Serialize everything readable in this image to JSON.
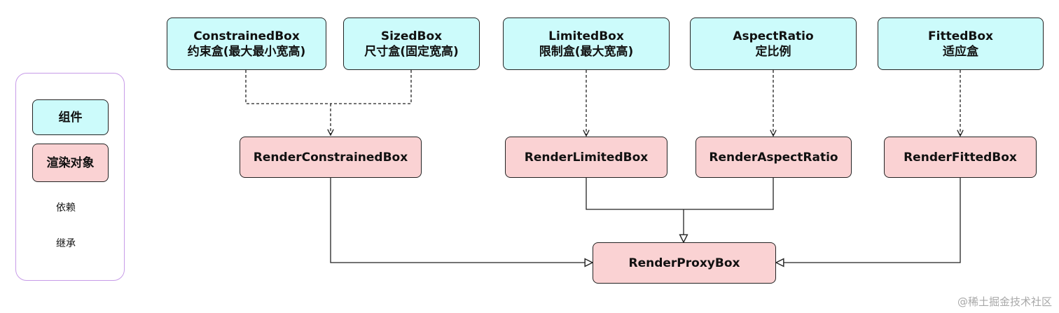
{
  "widgets": {
    "constrained_box": {
      "name": "ConstrainedBox",
      "desc": "约束盒(最大最小宽高)"
    },
    "sized_box": {
      "name": "SizedBox",
      "desc": "尺寸盒(固定宽高)"
    },
    "limited_box": {
      "name": "LimitedBox",
      "desc": "限制盒(最大宽高)"
    },
    "aspect_ratio": {
      "name": "AspectRatio",
      "desc": "定比例"
    },
    "fitted_box": {
      "name": "FittedBox",
      "desc": "适应盒"
    }
  },
  "render_objects": {
    "render_constrained_box": "RenderConstrainedBox",
    "render_limited_box": "RenderLimitedBox",
    "render_aspect_ratio": "RenderAspectRatio",
    "render_fitted_box": "RenderFittedBox",
    "render_proxy_box": "RenderProxyBox"
  },
  "legend": {
    "widget_label": "组件",
    "render_label": "渲染对象",
    "dependency_label": "依赖",
    "inheritance_label": "继承"
  },
  "colors": {
    "widget_fill": "#ccfbfb",
    "render_fill": "#fad2d3",
    "legend_border": "#c79be8",
    "line": "#222222"
  },
  "watermark": "@稀土掘金技术社区"
}
